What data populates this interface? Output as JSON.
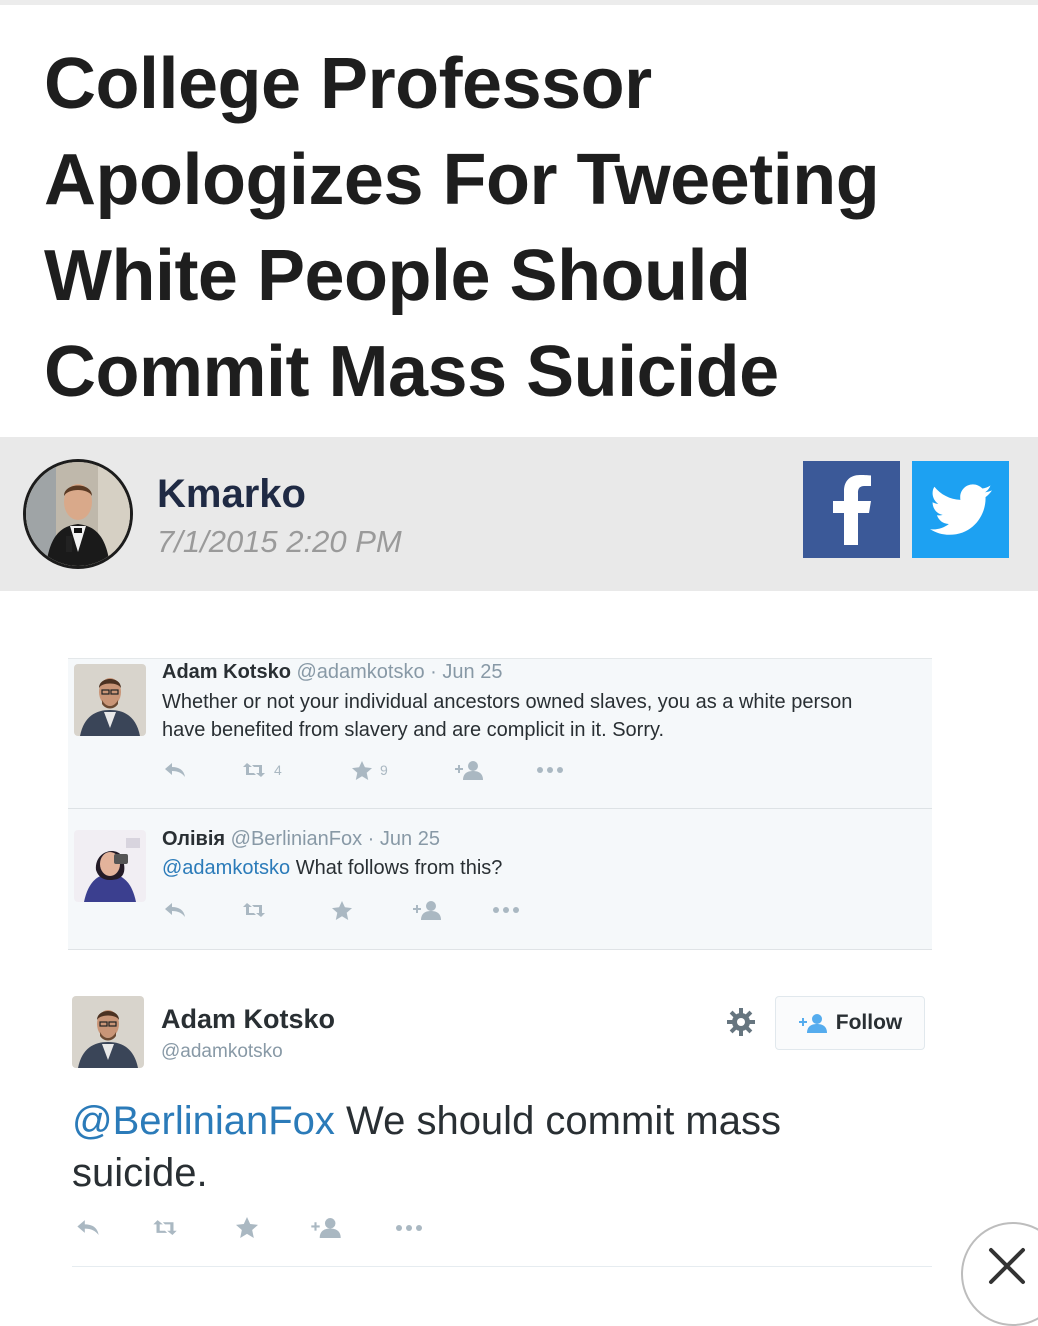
{
  "article": {
    "headline": "College Professor Apologizes For Tweeting White People Should Commit Mass Suicide",
    "author": "Kmarko",
    "date": "7/1/2015 2:20 PM"
  },
  "share": {
    "facebook_icon": "facebook-icon",
    "twitter_icon": "twitter-icon"
  },
  "tweets": [
    {
      "name": "Adam Kotsko",
      "handle": "@adamkotsko",
      "date": "Jun 25",
      "lines": [
        "Whether or not your individual ancestors owned slaves, you as a white person",
        "have benefited from slavery and are complicit in it. Sorry."
      ],
      "retweets": "4",
      "favorites": "9"
    },
    {
      "name": "Олівія",
      "handle": "@BerlinianFox",
      "date": "Jun 25",
      "mention": "@adamkotsko",
      "text": " What follows from this?"
    }
  ],
  "featured_tweet": {
    "name": "Adam Kotsko",
    "handle": "@adamkotsko",
    "follow_label": "Follow",
    "mention": "@BerlinianFox",
    "text_line1": " We should commit mass",
    "text_line2": "suicide."
  },
  "colors": {
    "facebook": "#3b5998",
    "twitter": "#1da1f2",
    "link": "#2b7bb9"
  }
}
